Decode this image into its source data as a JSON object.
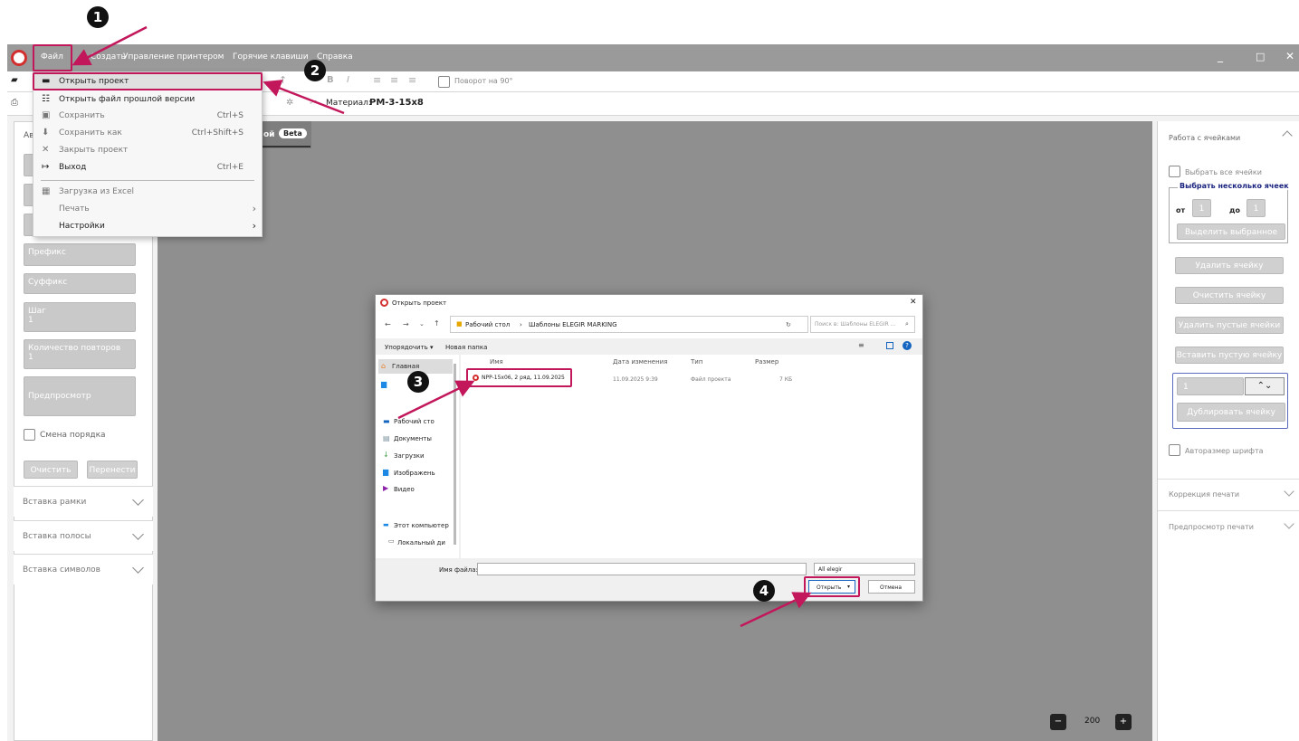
{
  "window": {
    "menus": [
      "Файл",
      "Создать",
      "Управление принтером",
      "Горячие клавиши",
      "Справка"
    ],
    "controls": [
      "_",
      "□",
      "✕"
    ]
  },
  "toolbar1": {
    "rotate_label": "Поворот на 90°",
    "bold": "B",
    "italic": "I"
  },
  "toolbar2": {
    "material_label": "Материал:",
    "material_value": "РМ-3-15х8"
  },
  "tabs": {
    "visible_tab": "ой",
    "beta_badge": "Beta"
  },
  "file_menu": {
    "items": [
      {
        "label": "Открыть проект",
        "shortcut": "",
        "icon": "folder-icon"
      },
      {
        "label": "Открыть файл прошлой версии",
        "shortcut": "",
        "icon": "tree-icon"
      },
      {
        "label": "Сохранить",
        "shortcut": "Ctrl+S",
        "icon": "save-icon"
      },
      {
        "label": "Сохранить как",
        "shortcut": "Ctrl+Shift+S",
        "icon": "download-icon"
      },
      {
        "label": "Закрыть проект",
        "shortcut": "",
        "icon": "close-icon"
      },
      {
        "label": "Выход",
        "shortcut": "Ctrl+E",
        "icon": "exit-icon"
      },
      {
        "label": "Загрузка из Excel",
        "shortcut": "",
        "icon": "table-icon"
      },
      {
        "label": "Печать",
        "shortcut": "",
        "icon": ""
      },
      {
        "label": "Настройки",
        "shortcut": "",
        "icon": ""
      }
    ]
  },
  "left_panel": {
    "header_stub": "Ав",
    "prefix_placeholder": "Префикс",
    "suffix_placeholder": "Суффикс",
    "step_label": "Шаг",
    "step_value": "1",
    "repeat_label": "Количество повторов",
    "repeat_value": "1",
    "preview_label": "Предпросмотр",
    "order_label": "Смена порядка",
    "clear_button": "Очистить",
    "move_button": "Перенести",
    "sections": [
      "Вставка рамки",
      "Вставка полосы",
      "Вставка символов"
    ]
  },
  "right_panel": {
    "cells_header": "Работа с ячейками",
    "select_all": "Выбрать все ячейки",
    "select_multiple": "Выбрать несколько ячеек",
    "from_label": "от",
    "from_value": "1",
    "to_label": "до",
    "to_value": "1",
    "select_selected": "Выделить выбранное",
    "delete_cell": "Удалить ячейку",
    "clear_cell": "Очистить ячейку",
    "delete_empty": "Удалить пустые ячейки",
    "insert_empty": "Вставить пустую ячейку",
    "dup_value": "1",
    "duplicate_cell": "Дублировать ячейку",
    "autosize": "Авторазмер шрифта",
    "print_correction": "Коррекция печати",
    "print_preview": "Предпросмотр печати"
  },
  "zoom": {
    "value": "200"
  },
  "dialog": {
    "title": "Открыть проект",
    "path": [
      "Рабочий стол",
      "Шаблоны ELEGIR MARKING"
    ],
    "search_placeholder": "Поиск в: Шаблоны ELEGIR ...",
    "organize": "Упорядочить ▾",
    "new_folder": "Новая папка",
    "columns": [
      "Имя",
      "Дата изменения",
      "Тип",
      "Размер"
    ],
    "file": {
      "name": "NPP-15x06, 2 ряд, 11.09.2025",
      "date": "11.09.2025 9:39",
      "type": "Файл проекта",
      "size": "7 КБ"
    },
    "nav": [
      "Главная",
      "Рабочий сто",
      "Документы",
      "Загрузки",
      "Изображень",
      "Видео",
      "Этот компьютер",
      "Локальный ди"
    ],
    "filename_label": "Имя файла:",
    "filter": "All elegir",
    "open_button": "Открыть",
    "cancel_button": "Отмена"
  },
  "annotations": {
    "steps": [
      "1",
      "2",
      "3",
      "4"
    ],
    "color": "#c2185b"
  }
}
